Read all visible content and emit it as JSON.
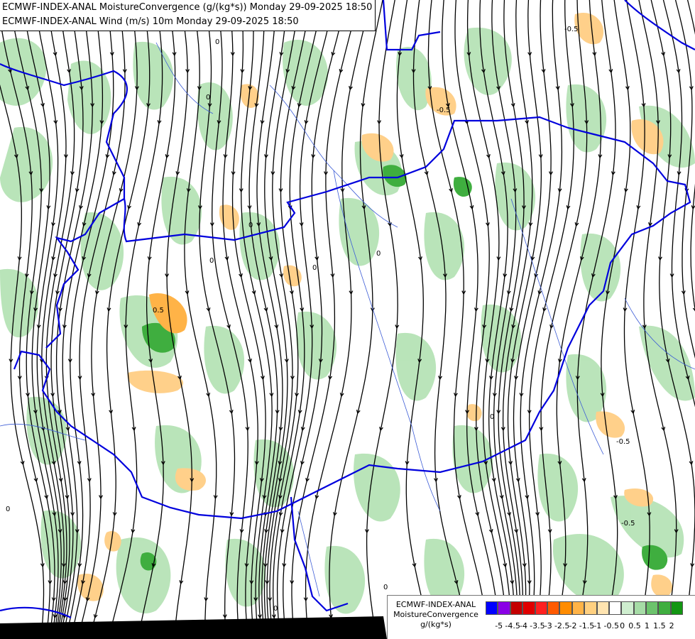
{
  "titles": {
    "line1": "ECMWF-INDEX-ANAL MoistureConvergence (g/(kg*s)) Monday 29-09-2025 18:50",
    "line2": "ECMWF-INDEX-ANAL Wind (m/s) 10m Monday 29-09-2025 18:50"
  },
  "legend": {
    "model": "ECMWF-INDEX-ANAL",
    "variable": "MoistureConvergence",
    "unit": "g/(kg*s)",
    "colors": [
      "#0000ff",
      "#8a00e6",
      "#c40000",
      "#e00000",
      "#ff2020",
      "#ff5a00",
      "#ff8c00",
      "#ffb347",
      "#ffd080",
      "#ffe4b0",
      "#ffffff",
      "#cfeecf",
      "#a6dca6",
      "#6cc36c",
      "#3fae3f",
      "#129612"
    ],
    "ticks": [
      "-5",
      "-4.5",
      "-4",
      "-3.5",
      "-3",
      "-2.5",
      "-2",
      "-1.5",
      "-1",
      "-0.5",
      "0",
      "0.5",
      "1",
      "1.5",
      "2"
    ]
  },
  "map": {
    "contour_labels": [
      "0",
      "0",
      "0",
      "0",
      "0",
      "0",
      "0",
      "0",
      "0",
      "0",
      "-0.5",
      "-0.5",
      "-0.5",
      "-0.5",
      "0.5"
    ],
    "colors": {
      "border": "#0000dd",
      "river": "#3c5cd6",
      "streamline": "#000000",
      "convergence_positive": "#b6e3b6",
      "convergence_strong": "#3fae3f",
      "convergence_negative": "#ffd08a"
    }
  }
}
